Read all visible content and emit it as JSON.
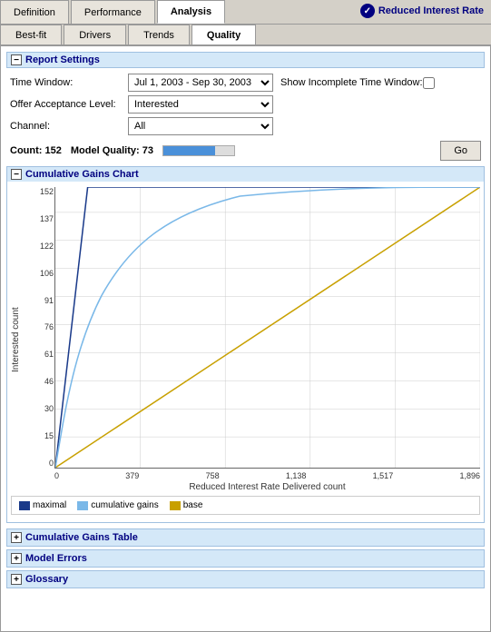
{
  "header": {
    "title": "Reduced Interest Rate",
    "tabs_top": [
      {
        "label": "Definition",
        "active": false
      },
      {
        "label": "Performance",
        "active": false
      },
      {
        "label": "Analysis",
        "active": true
      }
    ],
    "tabs_second": [
      {
        "label": "Best-fit",
        "active": false
      },
      {
        "label": "Drivers",
        "active": false
      },
      {
        "label": "Trends",
        "active": false
      },
      {
        "label": "Quality",
        "active": true
      }
    ]
  },
  "report_settings": {
    "section_title": "Report Settings",
    "time_window_label": "Time Window:",
    "time_window_value": "Jul 1, 2003 - Sep 30, 2003",
    "show_incomplete_label": "Show Incomplete Time Window:",
    "offer_acceptance_label": "Offer Acceptance Level:",
    "offer_acceptance_value": "Interested",
    "channel_label": "Channel:",
    "channel_value": "All"
  },
  "stats": {
    "count_label": "Count:",
    "count_value": "152",
    "quality_label": "Model Quality:",
    "quality_value": "73",
    "quality_percent": 73,
    "go_label": "Go"
  },
  "chart": {
    "section_title": "Cumulative Gains Chart",
    "y_axis_label": "Interested count",
    "x_axis_label": "Reduced Interest Rate Delivered count",
    "y_ticks": [
      "152",
      "137",
      "122",
      "106",
      "91",
      "76",
      "61",
      "46",
      "30",
      "15",
      "0"
    ],
    "x_ticks": [
      "0",
      "379",
      "758",
      "1,138",
      "1,517",
      "1,896"
    ],
    "legend": [
      {
        "label": "maximal",
        "color": "#1a3a8a"
      },
      {
        "label": "cumulative gains",
        "color": "#7ab8e8"
      },
      {
        "label": "base",
        "color": "#c8a000"
      }
    ]
  },
  "bottom_sections": [
    {
      "label": "Cumulative Gains Table"
    },
    {
      "label": "Model Errors"
    },
    {
      "label": "Glossary"
    }
  ]
}
